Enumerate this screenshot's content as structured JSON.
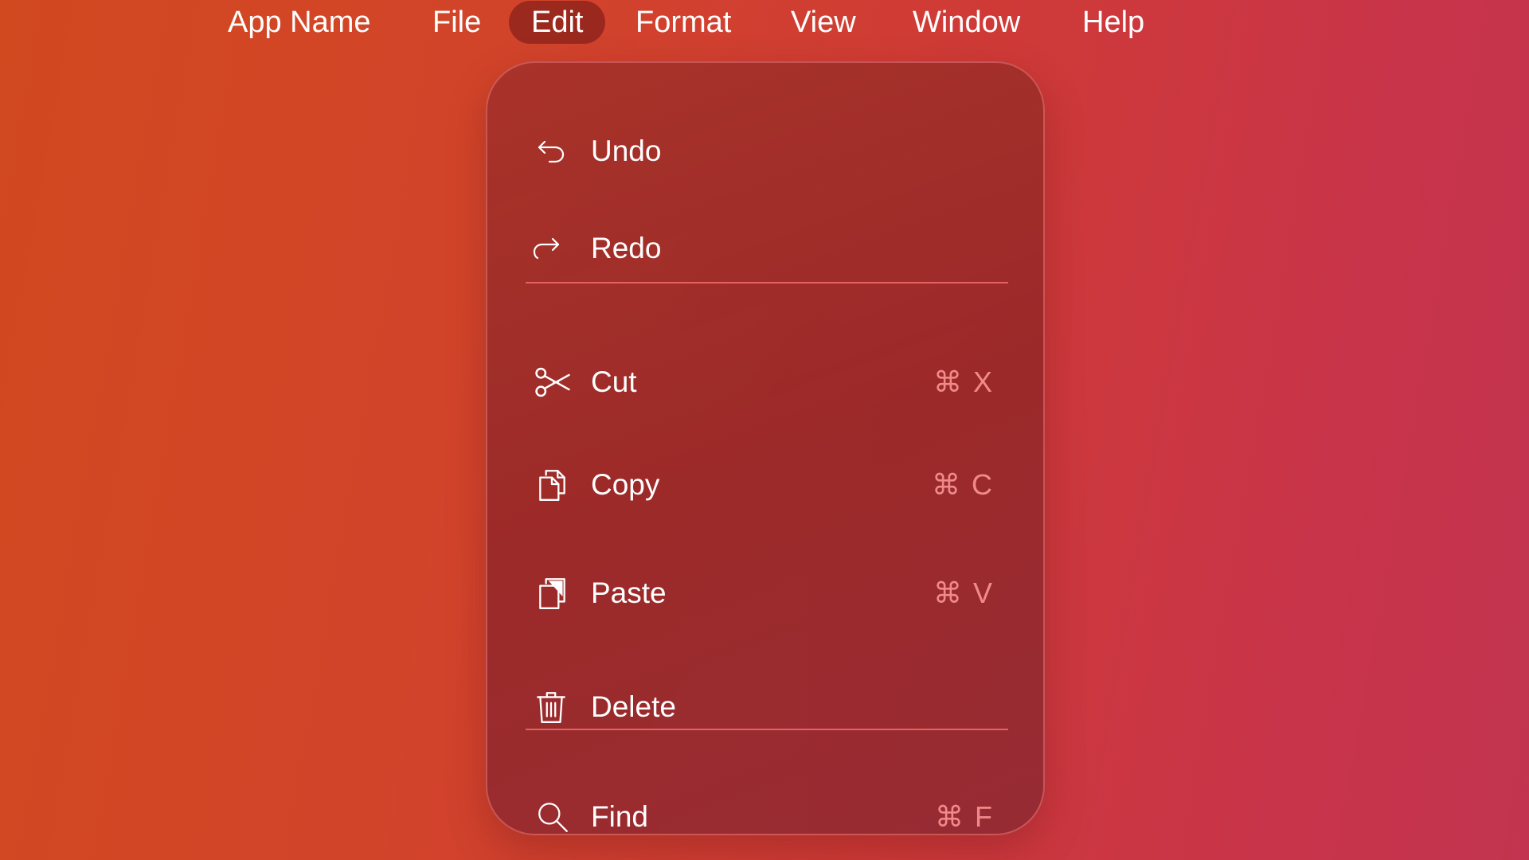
{
  "menubar": {
    "items": [
      {
        "label": "App Name"
      },
      {
        "label": "File"
      },
      {
        "label": "Edit"
      },
      {
        "label": "Format"
      },
      {
        "label": "View"
      },
      {
        "label": "Window"
      },
      {
        "label": "Help"
      }
    ],
    "active_item": "Edit"
  },
  "edit_menu": {
    "items": [
      {
        "label": "Undo",
        "icon": "undo-icon",
        "shortcut": ""
      },
      {
        "label": "Redo",
        "icon": "redo-icon",
        "shortcut": ""
      },
      {
        "label": "Cut",
        "icon": "scissors-icon",
        "shortcut": "⌘ X"
      },
      {
        "label": "Copy",
        "icon": "copy-icon",
        "shortcut": "⌘ C"
      },
      {
        "label": "Paste",
        "icon": "paste-icon",
        "shortcut": "⌘ V"
      },
      {
        "label": "Delete",
        "icon": "trash-icon",
        "shortcut": ""
      },
      {
        "label": "Find",
        "icon": "search-icon",
        "shortcut": "⌘ F"
      }
    ]
  },
  "colors": {
    "background_start": "#d1491f",
    "background_end": "#c2344f",
    "menu_panel": "#9c2e2e",
    "separator": "#e46262",
    "shortcut_text": "#f08a8a",
    "text": "#ffffff"
  }
}
